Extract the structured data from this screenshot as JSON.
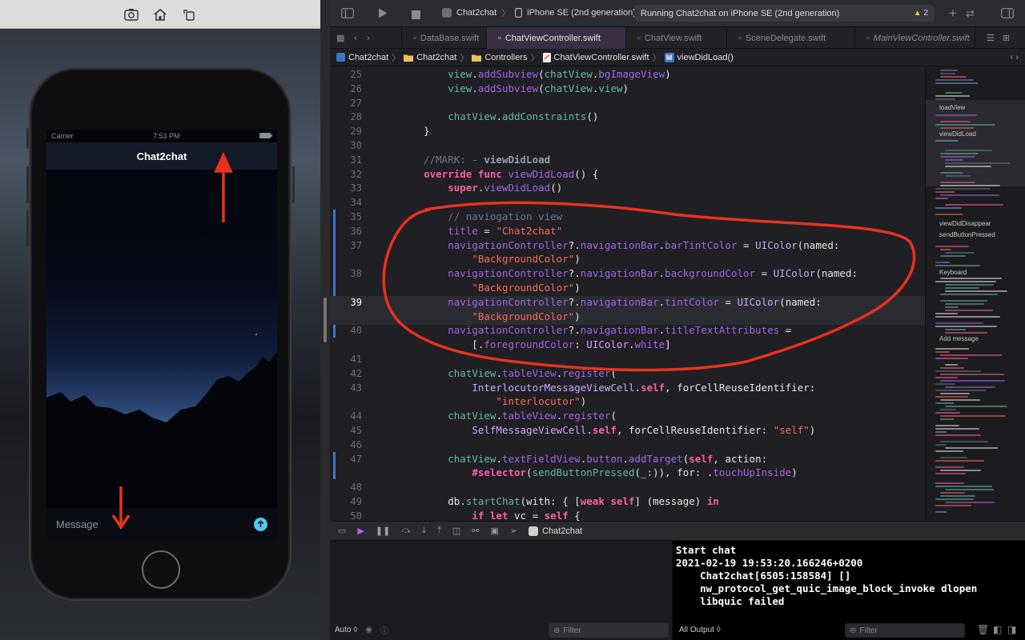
{
  "simulator": {
    "carrier": "Carrier",
    "time": "7:53 PM",
    "nav_title": "Chat2chat",
    "message_placeholder": "Message"
  },
  "xcode": {
    "scheme_app": "Chat2chat",
    "scheme_device": "iPhone SE (2nd generation)",
    "run_status": "Running Chat2chat on iPhone SE (2nd generation)",
    "warning_count": "2",
    "tabs": [
      {
        "label": "DataBase.swift"
      },
      {
        "label": "ChatViewController.swift"
      },
      {
        "label": "ChatView.swift"
      },
      {
        "label": "SceneDelegate.swift"
      },
      {
        "label": "MainViewController.swift"
      }
    ],
    "breadcrumbs": [
      "Chat2chat",
      "Chat2chat",
      "Controllers",
      "ChatViewController.swift",
      "viewDidLoad()"
    ],
    "code": [
      {
        "n": "25",
        "t": "        view.addSubview(chatView.bgImageView)"
      },
      {
        "n": "26",
        "t": "        view.addSubview(chatView.view)"
      },
      {
        "n": "27",
        "t": ""
      },
      {
        "n": "28",
        "t": "        chatView.addConstraints()"
      },
      {
        "n": "29",
        "t": "    }"
      },
      {
        "n": "30",
        "t": ""
      },
      {
        "n": "31",
        "t": "    //MARK: - viewDidLoad"
      },
      {
        "n": "32",
        "t": "    override func viewDidLoad() {"
      },
      {
        "n": "33",
        "t": "        super.viewDidLoad()"
      },
      {
        "n": "34",
        "t": ""
      },
      {
        "n": "35",
        "t": "        // naviogation view"
      },
      {
        "n": "36",
        "t": "        title = \"Chat2chat\""
      },
      {
        "n": "37",
        "t": "        navigationController?.navigationBar.barTintColor = UIColor(named:"
      },
      {
        "n": "",
        "t": "            \"BackgroundColor\")"
      },
      {
        "n": "38",
        "t": "        navigationController?.navigationBar.backgroundColor = UIColor(named:"
      },
      {
        "n": "",
        "t": "            \"BackgroundColor\")"
      },
      {
        "n": "39",
        "t": "        navigationController?.navigationBar.tintColor = UIColor(named:"
      },
      {
        "n": "",
        "t": "            \"BackgroundColor\")"
      },
      {
        "n": "40",
        "t": "        navigationController?.navigationBar.titleTextAttributes ="
      },
      {
        "n": "",
        "t": "            [.foregroundColor: UIColor.white]"
      },
      {
        "n": "41",
        "t": ""
      },
      {
        "n": "42",
        "t": "        chatView.tableView.register("
      },
      {
        "n": "43",
        "t": "            InterlocutorMessageViewCell.self, forCellReuseIdentifier:"
      },
      {
        "n": "",
        "t": "                \"interlocutor\")"
      },
      {
        "n": "44",
        "t": "        chatView.tableView.register("
      },
      {
        "n": "45",
        "t": "            SelfMessageViewCell.self, forCellReuseIdentifier: \"self\")"
      },
      {
        "n": "46",
        "t": ""
      },
      {
        "n": "47",
        "t": "        chatView.textFieldView.button.addTarget(self, action:"
      },
      {
        "n": "",
        "t": "            #selector(sendButtonPressed(_:)), for: .touchUpInside)"
      },
      {
        "n": "48",
        "t": ""
      },
      {
        "n": "49",
        "t": "        db.startChat(with: { [weak self] (message) in"
      },
      {
        "n": "50",
        "t": "            if let vc = self {"
      }
    ],
    "minimap_labels": [
      "loadView",
      "viewDidLoad",
      "viewDidDisappear",
      "sendButtonPressed",
      "Keyboard",
      "Add message"
    ],
    "debug_target": "Chat2chat",
    "console_text": "Start chat\n2021-02-19 19:53:20.166246+0200\n    Chat2chat[6505:158584] []\n    nw_protocol_get_quic_image_block_invoke dlopen\n    libquic failed",
    "vars_scope": "Auto ◊",
    "filter_placeholder": "Filter",
    "output_scope": "All Output ◊"
  },
  "colors": {
    "annotation": "#e8321e",
    "accent": "#3d78c9",
    "keyword": "#fc5fa3",
    "string": "#fc6a5d"
  }
}
